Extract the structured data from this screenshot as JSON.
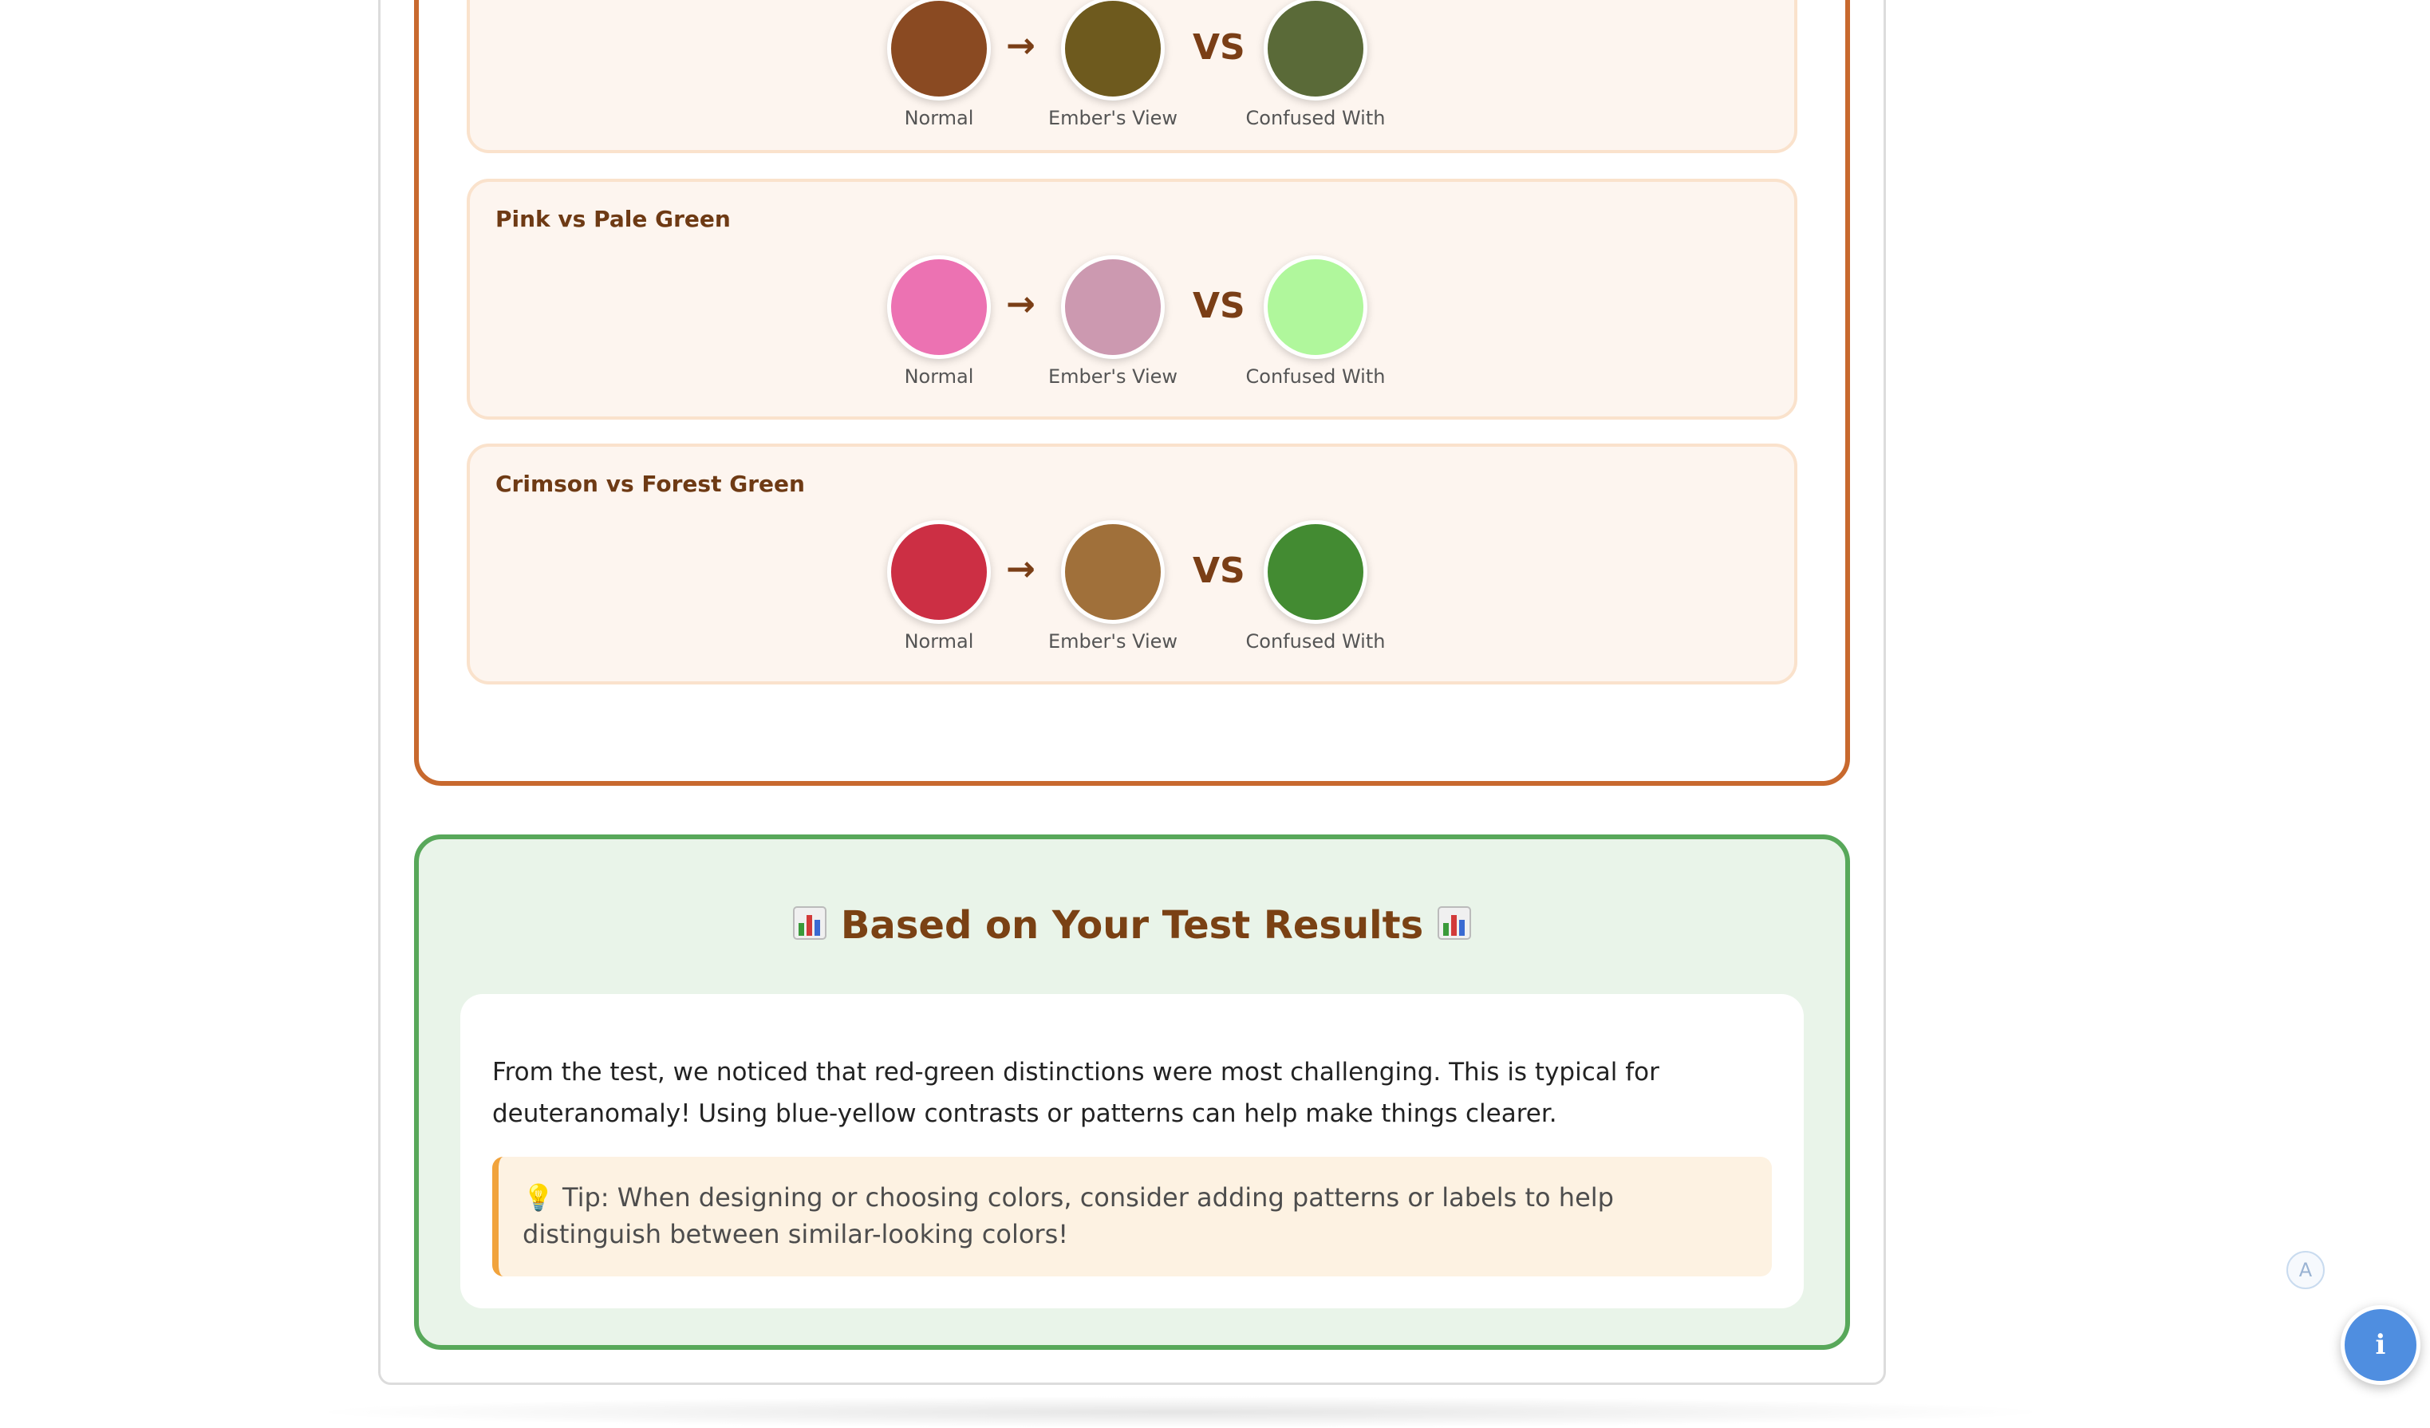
{
  "color_pairs": [
    {
      "title": "",
      "normal_color": "#8a4a22",
      "ember_color": "#6e5a1e",
      "confused_color": "#5a6a38",
      "normal_label": "Normal",
      "ember_label": "Ember's View",
      "confused_label": "Confused With",
      "arrow": "→",
      "vs": "VS"
    },
    {
      "title": "Pink vs Pale Green",
      "normal_color": "#ec72b2",
      "ember_color": "#cc99b0",
      "confused_color": "#b0f79c",
      "normal_label": "Normal",
      "ember_label": "Ember's View",
      "confused_label": "Confused With",
      "arrow": "→",
      "vs": "VS"
    },
    {
      "title": "Crimson vs Forest Green",
      "normal_color": "#cc2f44",
      "ember_color": "#a0703a",
      "confused_color": "#438b32",
      "normal_label": "Normal",
      "ember_label": "Ember's View",
      "confused_label": "Confused With",
      "arrow": "→",
      "vs": "VS"
    }
  ],
  "results": {
    "title": "Based on Your Test Results",
    "icon": "bar-chart-icon",
    "paragraph": "From the test, we noticed that red-green distinctions were most challenging. This is typical for deuteranomaly! Using blue-yellow contrasts or patterns can help make things clearer.",
    "tip_icon": "lightbulb-icon",
    "tip": "Tip: When designing or choosing colors, consider adding patterns or labels to help distinguish between similar-looking colors!"
  },
  "floating": {
    "badge_letter": "A",
    "info_symbol": "ℹ"
  },
  "colors": {
    "orange_border": "#c8692e",
    "green_border": "#58a85a",
    "title_brown": "#7a4114",
    "info_blue": "#4f8ee0"
  }
}
